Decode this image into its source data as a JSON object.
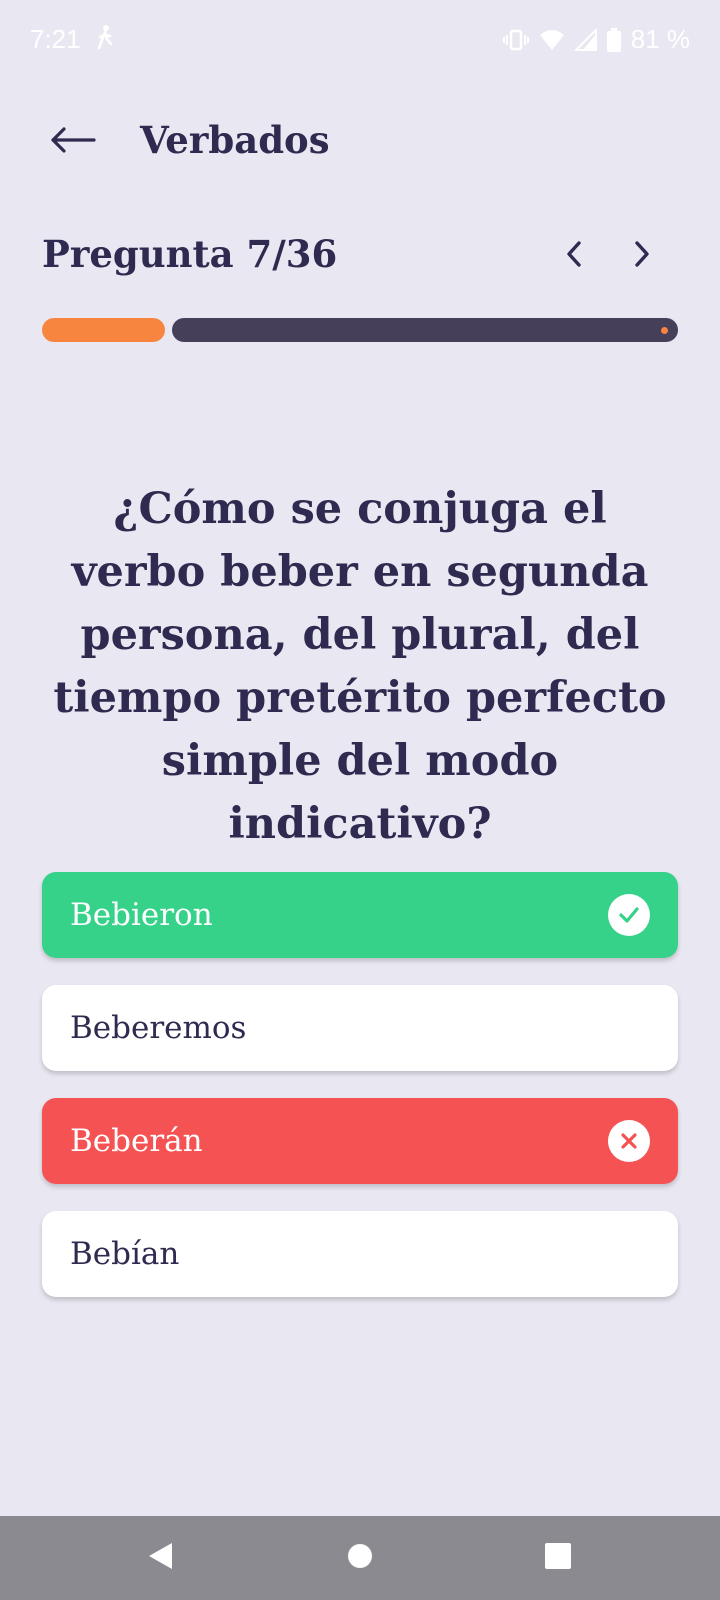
{
  "status_bar": {
    "time": "7:21",
    "battery": "81 %"
  },
  "header": {
    "title": "Verbados",
    "back_icon": "arrow-left-icon"
  },
  "quiz": {
    "counter": "Pregunta 7/36",
    "current": 7,
    "total": 36,
    "progress_fraction": 0.194,
    "question": "¿Cómo se conjuga el verbo beber en segunda persona, del plural, del tiempo pretérito perfecto simple del modo indicativo?",
    "options": [
      {
        "label": "Bebieron",
        "state": "correct",
        "icon": "check-icon"
      },
      {
        "label": "Beberemos",
        "state": "neutral"
      },
      {
        "label": "Beberán",
        "state": "wrong",
        "icon": "close-icon"
      },
      {
        "label": "Bebían",
        "state": "neutral"
      }
    ]
  },
  "colors": {
    "background": "#e9e8f2",
    "text": "#2f2a4f",
    "accent": "#f7853f",
    "progress_track": "#463f59",
    "correct": "#37d289",
    "wrong": "#f55253",
    "nav_bar": "#8b8a90"
  }
}
